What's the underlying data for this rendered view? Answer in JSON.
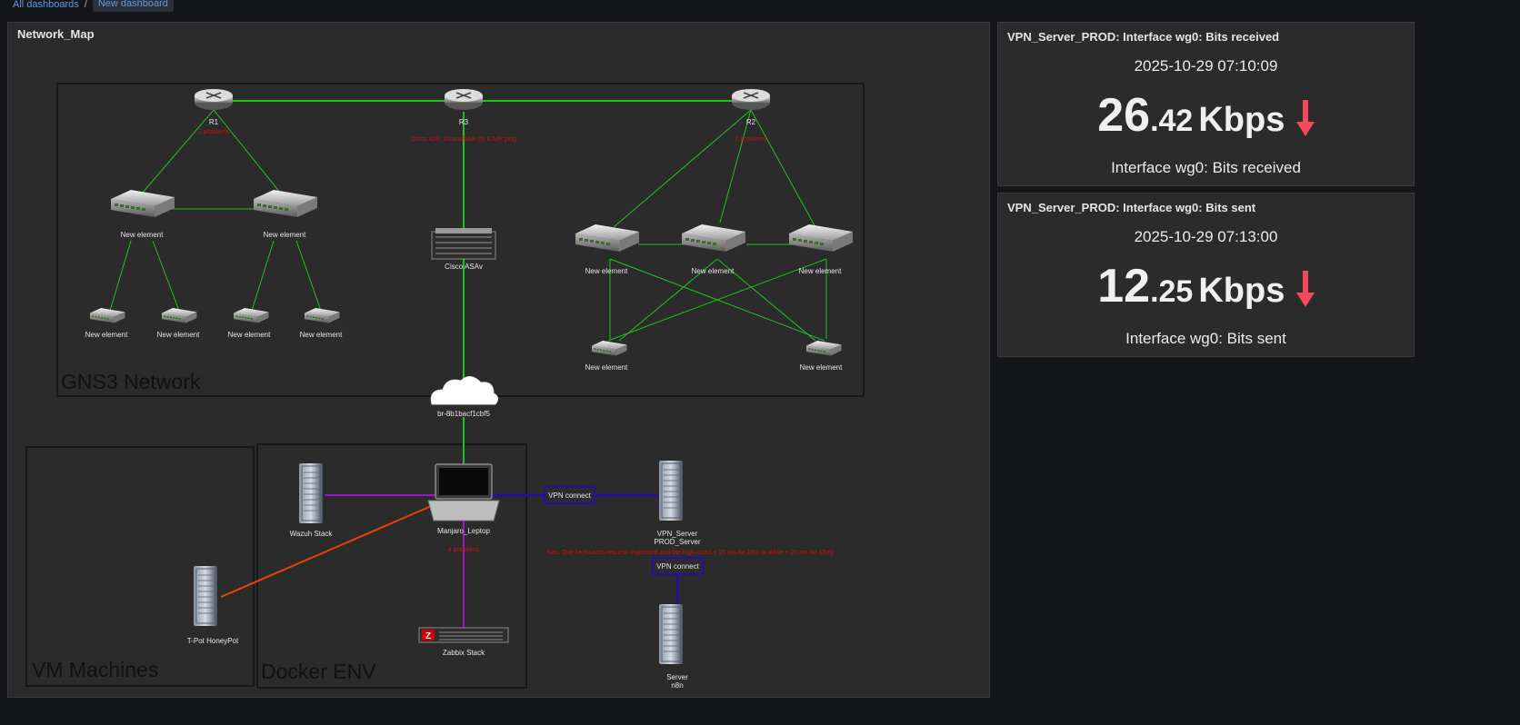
{
  "breadcrumb": {
    "root": "All dashboards",
    "separator": "/",
    "current": "New dashboard"
  },
  "map_widget": {
    "title": "Network_Map",
    "zones": {
      "gns3": "GNS3 Network",
      "vm": "VM Machines",
      "docker": "Docker ENV"
    },
    "nodes": {
      "r1": {
        "label": "R1",
        "problem": "2 problems"
      },
      "r3": {
        "label": "R3",
        "problem": "Cisco IOS: Unavailable by ICMP ping"
      },
      "r2": {
        "label": "R2",
        "problem": "2 problems"
      },
      "sw_a": "New element",
      "sw_b": "New element",
      "sw_c1": "New element",
      "sw_c2": "New element",
      "sw_c3": "New element",
      "sw_c4": "New element",
      "asa": "Cisco ASAv",
      "sw_r1": "New element",
      "sw_r2": "New element",
      "sw_r3": "New element",
      "sw_r4": "New element",
      "sw_r5": "New element",
      "cloud": "br-8b1bacf1cbf5",
      "wazuh": "Wazuh Stack",
      "laptop": {
        "label": "Manjaro_Leptop",
        "problem": "4 problems"
      },
      "vpn_server": {
        "line1": "VPN_Server",
        "line2": "PROD_Server",
        "problem": "Nas: One keyboards request registered and the high cross + 20 ms for 15m or while + 20 ms for 15m)"
      },
      "tpot": "T-Pot HoneyPot",
      "zabbix": "Zabbix Stack",
      "n8n": {
        "line1": "Server",
        "line2": "n8n"
      }
    },
    "link_labels": {
      "vpn1": "VPN connect",
      "vpn2": "VPN connect"
    },
    "colors": {
      "green": "#1ec31e",
      "purple": "#a012c8",
      "navy": "#2a0aa8",
      "orange": "#e8420a",
      "problem": "#cc1111"
    }
  },
  "widgets": [
    {
      "title": "VPN_Server_PROD: Interface wg0: Bits received",
      "timestamp": "2025-10-29 07:10:09",
      "value_int": "26",
      "value_dec": ".42",
      "unit": "Kbps",
      "trend": "down-arrow-icon",
      "description": "Interface wg0: Bits received"
    },
    {
      "title": "VPN_Server_PROD: Interface wg0: Bits sent",
      "timestamp": "2025-10-29 07:13:00",
      "value_int": "12",
      "value_dec": ".25",
      "unit": "Kbps",
      "trend": "down-arrow-icon",
      "description": "Interface wg0: Bits sent"
    }
  ],
  "accent": {
    "trend_down": "#f2495c",
    "link": "#5d9be0"
  }
}
